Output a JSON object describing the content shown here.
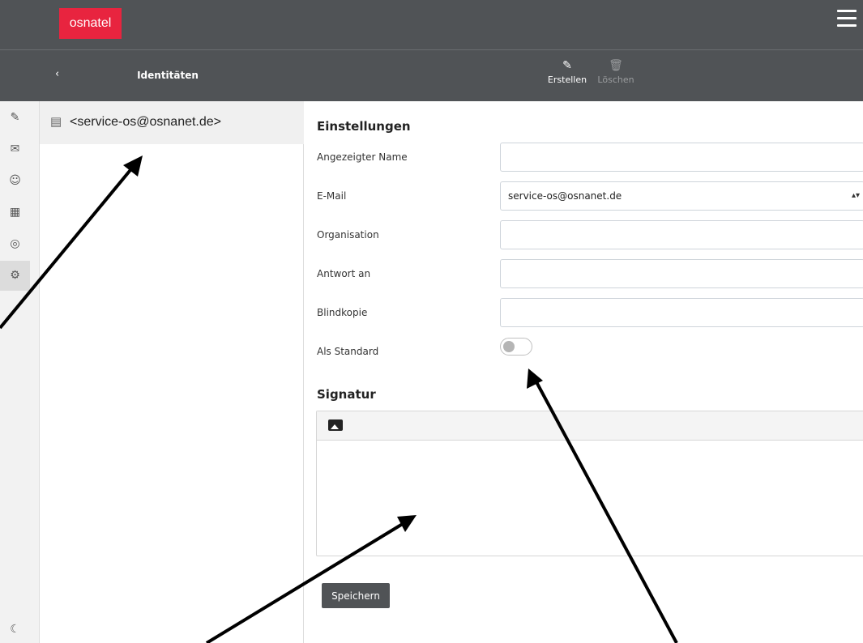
{
  "brand": {
    "logo_text": "osnatel",
    "accent": "#e8243f"
  },
  "header": {
    "menu_icon": "hamburger-icon"
  },
  "toolbar": {
    "back_label": "‹",
    "title": "Identitäten",
    "create_label": "Erstellen",
    "delete_label": "Löschen"
  },
  "rail": {
    "icons": [
      "compose-icon",
      "mail-icon",
      "contacts-icon",
      "calendar-icon",
      "help-icon",
      "settings-icon",
      "moon-icon"
    ]
  },
  "identities": {
    "items": [
      {
        "label": "<service-os@osnanet.de>"
      }
    ]
  },
  "form": {
    "section_title": "Einstellungen",
    "name_label": "Angezeigter Name",
    "name_value": "",
    "email_label": "E-Mail",
    "email_value": "service-os@osnanet.de",
    "org_label": "Organisation",
    "org_value": "",
    "reply_label": "Antwort an",
    "reply_value": "",
    "bcc_label": "Blindkopie",
    "bcc_value": "",
    "default_label": "Als Standard",
    "default_on": false
  },
  "signature": {
    "title": "Signatur",
    "content": ""
  },
  "actions": {
    "save_label": "Speichern"
  }
}
